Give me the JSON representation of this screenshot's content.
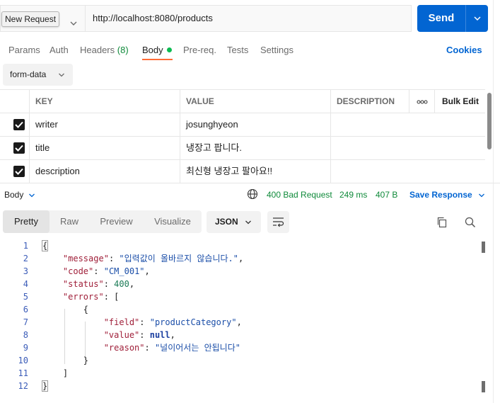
{
  "request": {
    "tooltip": "New Request",
    "url": "http://localhost:8080/products",
    "send_label": "Send"
  },
  "tabs": {
    "params": "Params",
    "auth": "Auth",
    "headers": "Headers",
    "headers_count": "(8)",
    "body": "Body",
    "prereq": "Pre-req.",
    "tests": "Tests",
    "settings": "Settings",
    "cookies": "Cookies"
  },
  "body_type": "form-data",
  "params_table": {
    "headers": {
      "key": "KEY",
      "value": "VALUE",
      "description": "DESCRIPTION",
      "more": "ooo",
      "bulk_edit": "Bulk Edit"
    },
    "rows": [
      {
        "key": "writer",
        "value": "josunghyeon",
        "description": ""
      },
      {
        "key": "title",
        "value": "냉장고 팝니다.",
        "description": ""
      },
      {
        "key": "description",
        "value": "최신형 냉장고 팔아요!!",
        "description": ""
      }
    ]
  },
  "response": {
    "section_label": "Body",
    "status": "400 Bad Request",
    "time": "249 ms",
    "size": "407 B",
    "save_label": "Save Response",
    "view_tabs": [
      "Pretty",
      "Raw",
      "Preview",
      "Visualize"
    ],
    "format": "JSON",
    "line_numbers": [
      "1",
      "2",
      "3",
      "4",
      "5",
      "6",
      "7",
      "8",
      "9",
      "10",
      "11",
      "12"
    ],
    "json": {
      "message_key": "\"message\"",
      "message_val": "\"입력값이 올바르지 않습니다.\"",
      "code_key": "\"code\"",
      "code_val": "\"CM_001\"",
      "status_key": "\"status\"",
      "status_val": "400",
      "errors_key": "\"errors\"",
      "field_key": "\"field\"",
      "field_val": "\"productCategory\"",
      "value_key": "\"value\"",
      "value_val": "null",
      "reason_key": "\"reason\"",
      "reason_val": "\"널이어서는 안됩니다\""
    }
  },
  "colors": {
    "accent_blue": "#0265d2",
    "active_tab_orange": "#ff6c37",
    "status_green": "#0f8a3a"
  }
}
